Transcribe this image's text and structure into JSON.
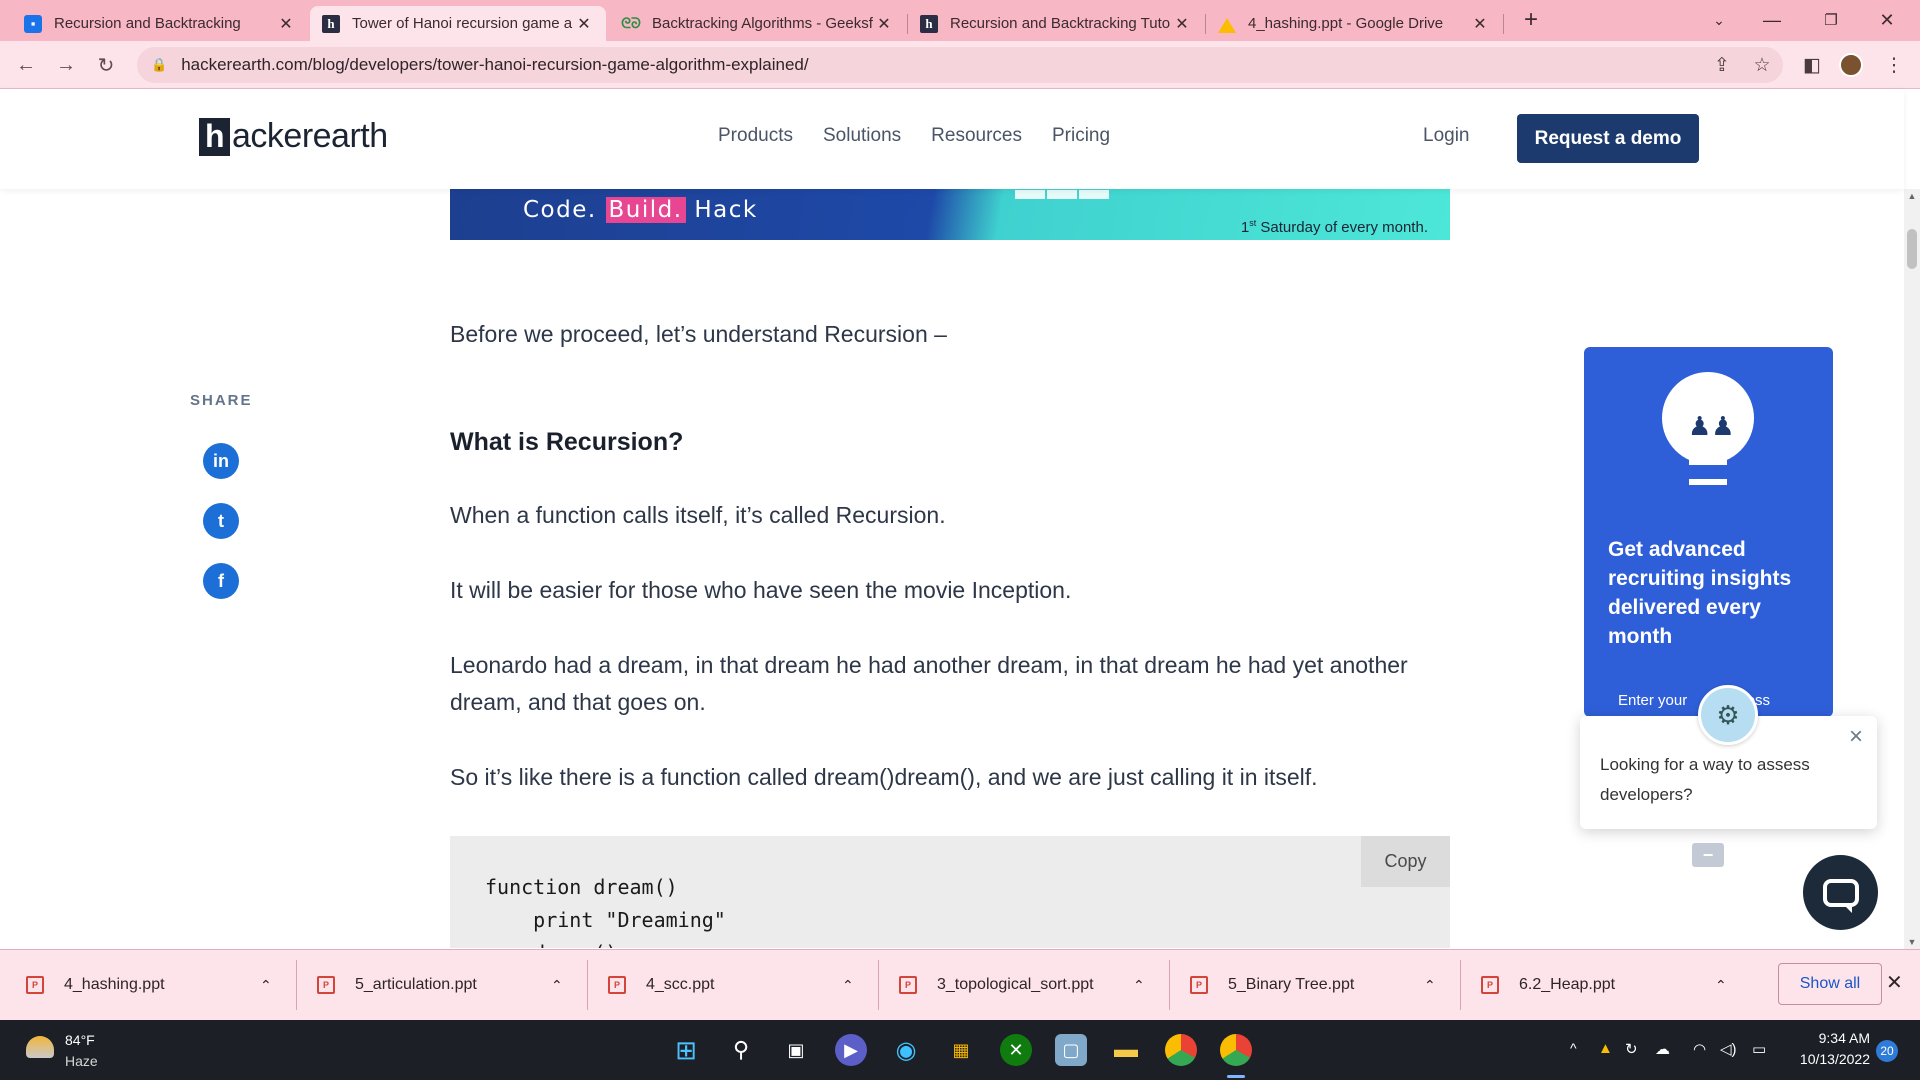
{
  "browser": {
    "tabs": [
      {
        "title": "Recursion and Backtracking",
        "favicon": "classroom-icon"
      },
      {
        "title": "Tower of Hanoi recursion game a",
        "favicon": "hackerearth-icon"
      },
      {
        "title": "Backtracking Algorithms - Geeksf",
        "favicon": "geeksforgeeks-icon"
      },
      {
        "title": "Recursion and Backtracking Tuto",
        "favicon": "hackerearth-icon"
      },
      {
        "title": "4_hashing.ppt - Google Drive",
        "favicon": "google-drive-icon"
      }
    ],
    "url": "hackerearth.com/blog/developers/tower-hanoi-recursion-game-algorithm-explained/"
  },
  "site": {
    "logo_letter": "h",
    "logo_rest": "ackerearth",
    "nav": [
      "Products",
      "Solutions",
      "Resources",
      "Pricing"
    ],
    "login": "Login",
    "cta": "Request a demo"
  },
  "banner": {
    "tag_pre": "Code. ",
    "tag_highlight": "Build.",
    "tag_post": " Hack",
    "schedule_sup": "st",
    "schedule_num": "1",
    "schedule_text": " Saturday of every month."
  },
  "article": {
    "p1": "Before we proceed, let’s understand Recursion –",
    "h2": "What is Recursion?",
    "p2": "When a function calls itself, it’s called Recursion.",
    "p3": "It will be easier for those who have seen the movie Inception.",
    "p4": "Leonardo had a dream, in that dream he had another dream, in that dream he had yet another dream, and that goes on.",
    "p5": "So it’s like there is a function called dream()dream(), and we are just calling it in itself.",
    "code": "function dream()\n    print \"Dreaming\"\n    dream()",
    "copy": "Copy"
  },
  "share": {
    "label": "SHARE",
    "networks": [
      "in",
      "t",
      "f"
    ]
  },
  "promo": {
    "headline": "Get advanced recruiting insights delivered every month",
    "email_hint_pre": "Enter your ",
    "email_hint_post": "dress"
  },
  "chat": {
    "message": "Looking for a way to assess developers?"
  },
  "downloads": {
    "files": [
      "4_hashing.ppt",
      "5_articulation.ppt",
      "4_scc.ppt",
      "3_topological_sort.ppt",
      "5_Binary Tree.ppt",
      "6.2_Heap.ppt"
    ],
    "show_all": "Show all"
  },
  "taskbar": {
    "temp": "84°F",
    "condition": "Haze",
    "time": "9:34 AM",
    "date": "10/13/2022",
    "notifications": "20"
  },
  "colors": {
    "tab_strip": "#f8b7c4",
    "brand_navy": "#1c3a6e",
    "promo_blue": "#2f5fd8",
    "share_blue": "#1d6fd8"
  }
}
